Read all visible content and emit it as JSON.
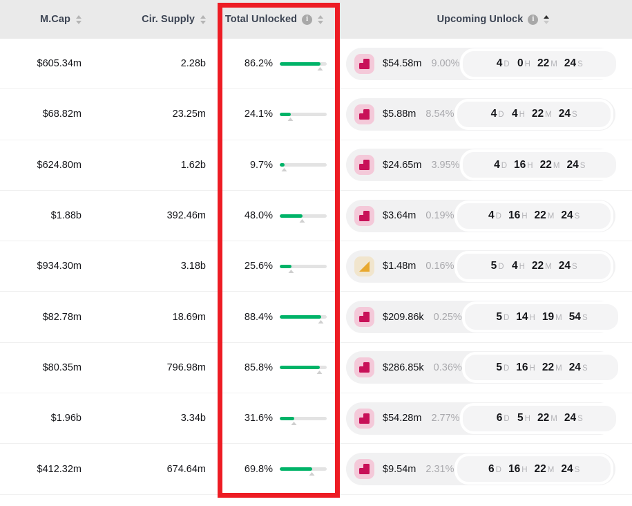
{
  "header": {
    "columns": [
      {
        "label": "M.Cap",
        "has_info": false,
        "sort": "none"
      },
      {
        "label": "Cir. Supply",
        "has_info": false,
        "sort": "none"
      },
      {
        "label": "Total Unlocked",
        "has_info": true,
        "sort": "none"
      },
      {
        "label": "Upcoming Unlock",
        "has_info": true,
        "sort": "asc"
      }
    ],
    "info_glyph": "i"
  },
  "units": {
    "days": "D",
    "hours": "H",
    "minutes": "M",
    "seconds": "S"
  },
  "colors": {
    "progress_fill": "#00b368",
    "progress_track": "#e3e3e3",
    "header_bg": "#eaeaea",
    "annotation": "#ed1c24",
    "cliff_icon": "#c81058",
    "cliff_icon_bg": "#f4c9d9",
    "linear_icon": "#e8a82e",
    "linear_icon_bg": "#f1e5cd"
  },
  "annotation": {
    "name": "total-unlocked-column-highlight"
  },
  "rows": [
    {
      "mcap": "$605.34m",
      "supply": "2.28b",
      "unlocked_pct": "86.2%",
      "unlocked_value": 86.2,
      "unlock_type": "cliff",
      "unlock_amount": "$54.58m",
      "unlock_share": "9.00%",
      "timer": {
        "d": "4",
        "h": "0",
        "m": "22",
        "s": "24"
      }
    },
    {
      "mcap": "$68.82m",
      "supply": "23.25m",
      "unlocked_pct": "24.1%",
      "unlocked_value": 24.1,
      "unlock_type": "cliff",
      "unlock_amount": "$5.88m",
      "unlock_share": "8.54%",
      "timer": {
        "d": "4",
        "h": "4",
        "m": "22",
        "s": "24"
      }
    },
    {
      "mcap": "$624.80m",
      "supply": "1.62b",
      "unlocked_pct": "9.7%",
      "unlocked_value": 9.7,
      "unlock_type": "cliff",
      "unlock_amount": "$24.65m",
      "unlock_share": "3.95%",
      "timer": {
        "d": "4",
        "h": "16",
        "m": "22",
        "s": "24"
      }
    },
    {
      "mcap": "$1.88b",
      "supply": "392.46m",
      "unlocked_pct": "48.0%",
      "unlocked_value": 48.0,
      "unlock_type": "cliff",
      "unlock_amount": "$3.64m",
      "unlock_share": "0.19%",
      "timer": {
        "d": "4",
        "h": "16",
        "m": "22",
        "s": "24"
      }
    },
    {
      "mcap": "$934.30m",
      "supply": "3.18b",
      "unlocked_pct": "25.6%",
      "unlocked_value": 25.6,
      "unlock_type": "linear",
      "unlock_amount": "$1.48m",
      "unlock_share": "0.16%",
      "timer": {
        "d": "5",
        "h": "4",
        "m": "22",
        "s": "24"
      }
    },
    {
      "mcap": "$82.78m",
      "supply": "18.69m",
      "unlocked_pct": "88.4%",
      "unlocked_value": 88.4,
      "unlock_type": "cliff",
      "unlock_amount": "$209.86k",
      "unlock_share": "0.25%",
      "timer": {
        "d": "5",
        "h": "14",
        "m": "19",
        "s": "54"
      }
    },
    {
      "mcap": "$80.35m",
      "supply": "796.98m",
      "unlocked_pct": "85.8%",
      "unlocked_value": 85.8,
      "unlock_type": "cliff",
      "unlock_amount": "$286.85k",
      "unlock_share": "0.36%",
      "timer": {
        "d": "5",
        "h": "16",
        "m": "22",
        "s": "24"
      }
    },
    {
      "mcap": "$1.96b",
      "supply": "3.34b",
      "unlocked_pct": "31.6%",
      "unlocked_value": 31.6,
      "unlock_type": "cliff",
      "unlock_amount": "$54.28m",
      "unlock_share": "2.77%",
      "timer": {
        "d": "6",
        "h": "5",
        "m": "22",
        "s": "24"
      }
    },
    {
      "mcap": "$412.32m",
      "supply": "674.64m",
      "unlocked_pct": "69.8%",
      "unlocked_value": 69.8,
      "unlock_type": "cliff",
      "unlock_amount": "$9.54m",
      "unlock_share": "2.31%",
      "timer": {
        "d": "6",
        "h": "16",
        "m": "22",
        "s": "24"
      }
    }
  ]
}
